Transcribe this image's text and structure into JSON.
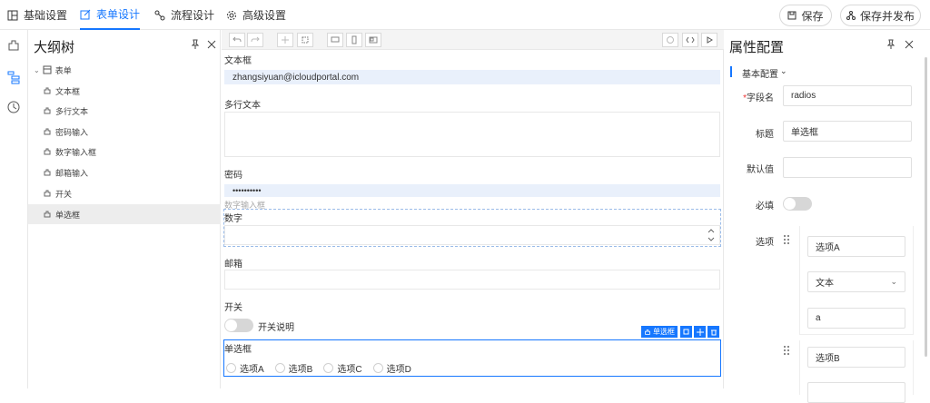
{
  "top_tabs": [
    {
      "label": "基础设置",
      "icon": "layout-icon"
    },
    {
      "label": "表单设计",
      "icon": "edit-icon"
    },
    {
      "label": "流程设计",
      "icon": "flow-icon"
    },
    {
      "label": "高级设置",
      "icon": "gear-icon"
    }
  ],
  "actions": {
    "save": "保存",
    "save_publish": "保存并发布"
  },
  "outline": {
    "title": "大纲树",
    "root": "表单",
    "items": [
      "文本框",
      "多行文本",
      "密码输入",
      "数字输入框",
      "邮箱输入",
      "开关",
      "单选框"
    ],
    "selected_index": 6
  },
  "canvas": {
    "fields": {
      "text_label": "文本框",
      "text_value": "zhangsiyuan@icloudportal.com",
      "textarea_label": "多行文本",
      "password_label": "密码",
      "password_value": "••••••••••",
      "number_ghost": "数字输入框",
      "number_label": "数字",
      "email_label": "邮箱",
      "switch_label": "开关",
      "switch_desc": "开关说明",
      "radio_label": "单选框",
      "radio_options": [
        "选项A",
        "选项B",
        "选项C",
        "选项D"
      ]
    },
    "selected_badge": "单选框"
  },
  "props": {
    "title": "属性配置",
    "section": "基本配置",
    "field_name_label": "字段名",
    "field_name_value": "radios",
    "title_label": "标题",
    "title_value": "单选框",
    "default_label": "默认值",
    "required_label": "必填",
    "options_label": "选项",
    "option_a": "选项A",
    "option_type": "文本",
    "option_a_value": "a",
    "option_b": "选项B"
  },
  "colors": {
    "accent": "#1677ff",
    "selected_row": "#ededed",
    "filled_input": "#e9f0fb"
  }
}
